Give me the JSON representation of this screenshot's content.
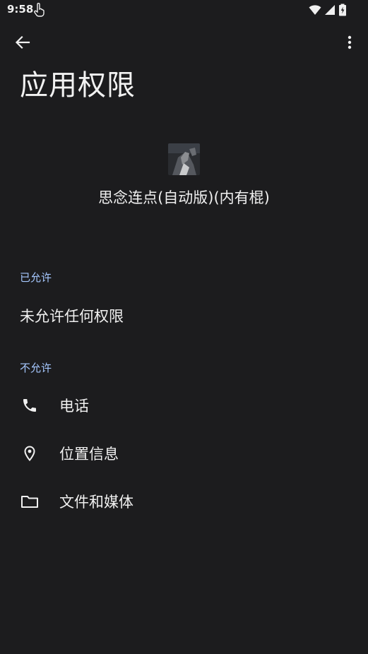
{
  "status_bar": {
    "time": "9:58",
    "icons": [
      "touch-icon",
      "wifi-icon",
      "cell-signal-icon",
      "battery-icon"
    ]
  },
  "app_bar": {
    "back_icon": "arrow-back-icon",
    "more_icon": "more-vertical-icon"
  },
  "page": {
    "title": "应用权限"
  },
  "app": {
    "name": "思念连点(自动版)(内有棍)"
  },
  "sections": {
    "allowed": {
      "header": "已允许",
      "empty_text": "未允许任何权限"
    },
    "denied": {
      "header": "不允许",
      "items": [
        {
          "label": "电话",
          "icon": "phone-icon"
        },
        {
          "label": "位置信息",
          "icon": "location-pin-icon"
        },
        {
          "label": "文件和媒体",
          "icon": "folder-icon"
        }
      ]
    }
  },
  "colors": {
    "background": "#1c1c1e",
    "text": "#f0f0f0",
    "section_header": "#a6c8ff"
  }
}
